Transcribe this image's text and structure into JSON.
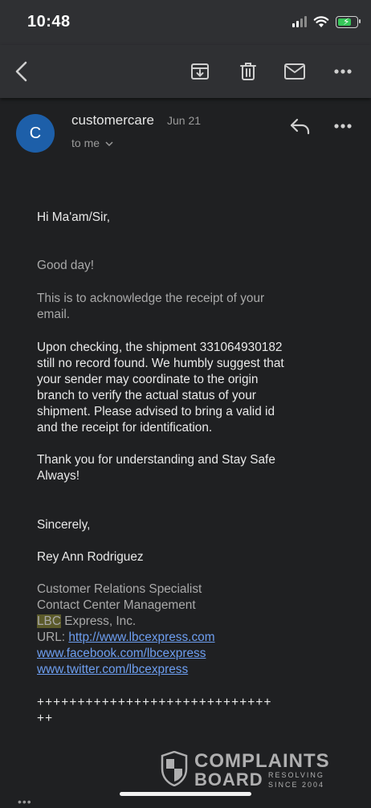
{
  "status": {
    "time": "10:48"
  },
  "toolbar": {
    "back": "back-arrow-icon",
    "archive": "archive-icon",
    "delete": "trash-icon",
    "mark_unread": "mail-icon",
    "more": "more-icon"
  },
  "sender": {
    "avatar_letter": "C",
    "name": "customercare",
    "date": "Jun 21",
    "to": "to me",
    "avatar_color": "#1d5fa9"
  },
  "message": {
    "greeting": "Hi Ma'am/Sir,",
    "good_day": "Good day!",
    "ack_line1": "This is to acknowledge the receipt of your",
    "ack_line2": "email.",
    "p3": [
      "Upon checking, the shipment 331064930182",
      "still no record found. We humbly suggest that",
      "your sender may coordinate to the origin",
      "branch to verify the actual status of your",
      "shipment. Please advised to bring a valid id",
      "and the receipt for identification."
    ],
    "thanks": [
      "Thank you for understanding and Stay Safe",
      "Always!"
    ],
    "closing": "Sincerely,",
    "signer": "Rey Ann Rodriguez",
    "title": "Customer Relations Specialist",
    "department": "Contact Center Management",
    "company_prefix": "LBC",
    "company_rest": " Express, Inc.",
    "url_label": "URL: ",
    "url": "http://www.lbcexpress.com",
    "facebook": "www.facebook.com/lbcexpress",
    "twitter": "www.twitter.com/lbcexpress",
    "separator1": "+++++++++++++++++++++++++++++",
    "separator2": "++"
  },
  "watermark": {
    "line1": "COMPLAINTS",
    "line2": "BOARD",
    "sub1": "RESOLVING",
    "sub2": "SINCE 2004"
  },
  "bottom": {
    "dots": "•••"
  },
  "colors": {
    "link": "#6d9ef0",
    "background": "#1f2022",
    "toolbar": "#2f3033",
    "battery": "#36c759"
  }
}
